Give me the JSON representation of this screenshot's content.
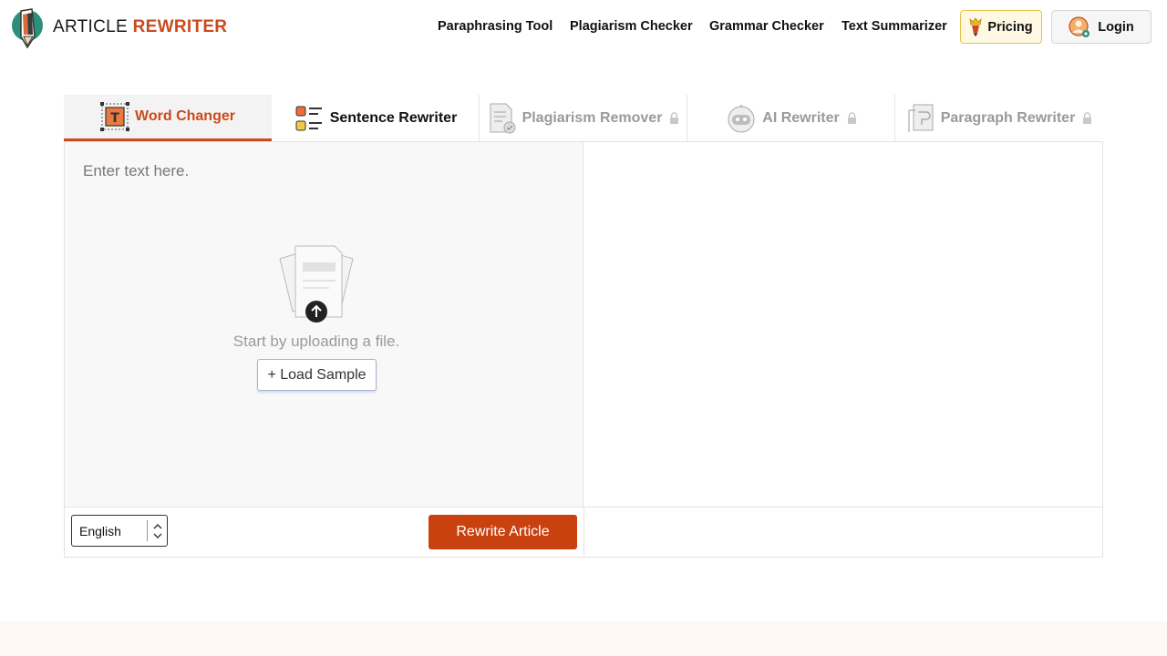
{
  "brand": {
    "name_part1": "ARTICLE",
    "name_part2": "REWRITER"
  },
  "nav": {
    "items": [
      "Paraphrasing Tool",
      "Plagiarism Checker",
      "Grammar Checker",
      "Text Summarizer"
    ],
    "pricing_label": "Pricing",
    "login_label": "Login"
  },
  "tabs": [
    {
      "label": "Word Changer",
      "state": "active"
    },
    {
      "label": "Sentence Rewriter",
      "state": "normal"
    },
    {
      "label": "Plagiarism Remover",
      "state": "locked"
    },
    {
      "label": "AI Rewriter",
      "state": "locked"
    },
    {
      "label": "Paragraph Rewriter",
      "state": "locked"
    }
  ],
  "editor": {
    "placeholder": "Enter text here.",
    "upload_caption": "Start by uploading a file.",
    "load_sample_label": "+ Load Sample"
  },
  "controls": {
    "language": "English",
    "rewrite_label": "Rewrite Article"
  },
  "colors": {
    "accent": "#c94a1c",
    "button": "#c9410f",
    "pricing_bg": "#fff9e3",
    "footer_bg": "#fef7f3"
  }
}
